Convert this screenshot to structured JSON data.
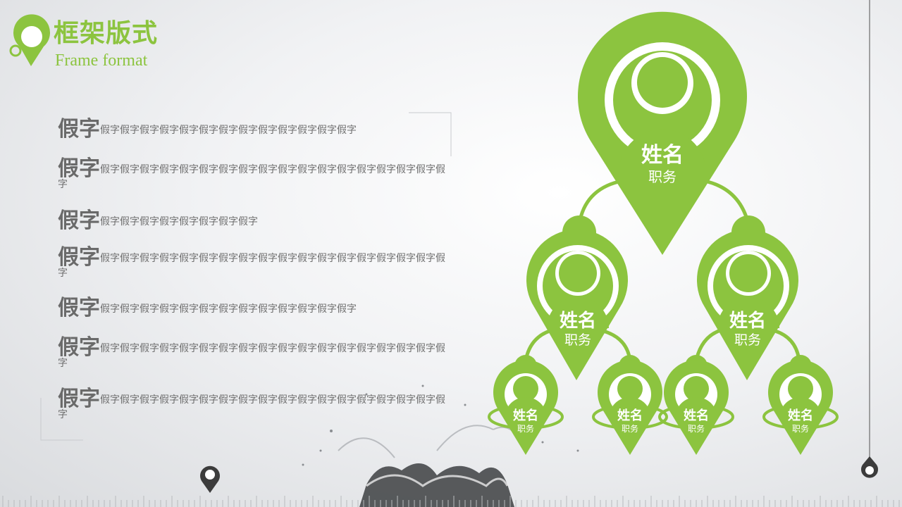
{
  "colors": {
    "accent": "#8cc43f",
    "text": "#6f6f6f",
    "dark": "#4a4a4a"
  },
  "header": {
    "title": "框架版式",
    "subtitle": "Frame format",
    "logo_icon": "map-pin-icon"
  },
  "text_list": [
    {
      "lead": "假字",
      "body": "假字假字假字假字假字假字假字假字假字假字假字假字假字"
    },
    {
      "lead": "假字",
      "body": "假字假字假字假字假字假字假字假字假字假字假字假字假字假字假字假字假字假字"
    },
    {
      "lead": "假字",
      "body": "假字假字假字假字假字假字假字假字"
    },
    {
      "lead": "假字",
      "body": "假字假字假字假字假字假字假字假字假字假字假字假字假字假字假字假字假字假字"
    },
    {
      "lead": "假字",
      "body": "假字假字假字假字假字假字假字假字假字假字假字假字假字"
    },
    {
      "lead": "假字",
      "body": "假字假字假字假字假字假字假字假字假字假字假字假字假字假字假字假字假字假字"
    },
    {
      "lead": "假字",
      "body": "假字假字假字假字假字假字假字假字假字假字假字假字假字假字假字假字假字假字"
    }
  ],
  "org_chart": {
    "root": {
      "name": "姓名",
      "role": "职务",
      "icon": "person-icon"
    },
    "level2": [
      {
        "name": "姓名",
        "role": "职务",
        "icon": "person-icon"
      },
      {
        "name": "姓名",
        "role": "职务",
        "icon": "person-icon"
      }
    ],
    "level3": [
      {
        "name": "姓名",
        "role": "职务",
        "icon": "person-icon"
      },
      {
        "name": "姓名",
        "role": "职务",
        "icon": "person-icon"
      },
      {
        "name": "姓名",
        "role": "职务",
        "icon": "person-icon"
      },
      {
        "name": "姓名",
        "role": "职务",
        "icon": "person-icon"
      }
    ]
  },
  "decorations": {
    "bottom_pin_icon": "map-pin-icon",
    "right_drop_icon": "drop-icon",
    "splash_image": "water-splash"
  }
}
